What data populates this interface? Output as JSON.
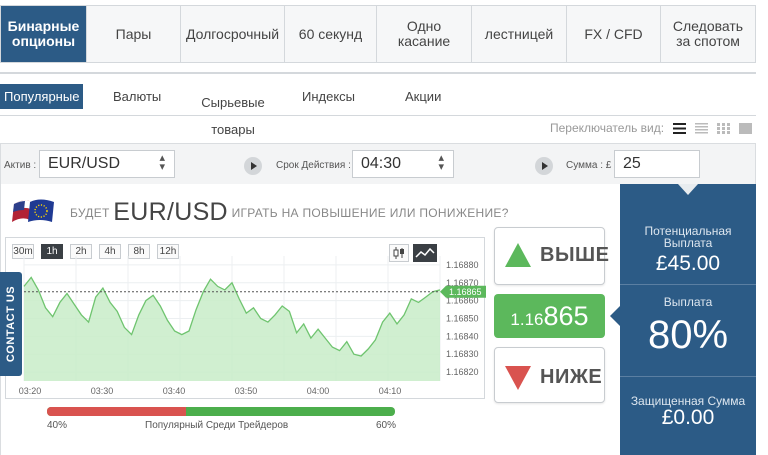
{
  "top_nav": [
    {
      "label": "Бинарные опционы",
      "active": true
    },
    {
      "label": "Пары"
    },
    {
      "label": "Долгосрочный"
    },
    {
      "label": "60 секунд"
    },
    {
      "label": "Одно касание"
    },
    {
      "label": "лестницей"
    },
    {
      "label": "FX / CFD"
    },
    {
      "label": "Следовать за спотом"
    }
  ],
  "sub_nav": [
    {
      "label": "Популярные",
      "active": true
    },
    {
      "label": "Валюты"
    },
    {
      "label": "Сырьевые товары"
    },
    {
      "label": "Индексы"
    },
    {
      "label": "Акции"
    }
  ],
  "view_switch": {
    "label": "Переключатель вид:"
  },
  "controls": {
    "asset_label": "Актив :",
    "asset_value": "EUR/USD",
    "expiry_label": "Срок Действия :",
    "expiry_value": "04:30",
    "amount_label": "Сумма : £",
    "amount_value": "25"
  },
  "headline": {
    "prefix": "БУДЕТ",
    "pair": "EUR/USD",
    "suffix": "ИГРАТЬ НА ПОВЫШЕНИЕ ИЛИ ПОНИЖЕНИЕ?"
  },
  "timeframes": [
    "30m",
    "1h",
    "2h",
    "4h",
    "8h",
    "12h"
  ],
  "active_timeframe": "1h",
  "contact_label": "CONTACT US",
  "chart_data": {
    "type": "area",
    "x_ticks": [
      "03:20",
      "03:30",
      "03:40",
      "03:50",
      "04:00",
      "04:10"
    ],
    "y_ticks": [
      "1.16880",
      "1.16870",
      "1.16860",
      "1.16850",
      "1.16840",
      "1.16830",
      "1.16820"
    ],
    "ylim": [
      1.16815,
      1.16885
    ],
    "current_price_label": "1.16865",
    "series": [
      {
        "values": [
          1.16868,
          1.16873,
          1.16866,
          1.16856,
          1.16851,
          1.16859,
          1.16864,
          1.16858,
          1.16852,
          1.16848,
          1.16862,
          1.16867,
          1.16859,
          1.16854,
          1.16845,
          1.16841,
          1.16852,
          1.1686,
          1.16863,
          1.16857,
          1.16849,
          1.16843,
          1.16841,
          1.16843,
          1.16855,
          1.16865,
          1.16872,
          1.16868,
          1.16866,
          1.1687,
          1.16861,
          1.16853,
          1.16856,
          1.1685,
          1.16848,
          1.16852,
          1.16857,
          1.16854,
          1.16842,
          1.16847,
          1.16839,
          1.16844,
          1.16839,
          1.16834,
          1.16832,
          1.16837,
          1.1683,
          1.16829,
          1.16833,
          1.16838,
          1.16848,
          1.16853,
          1.16847,
          1.16852,
          1.16861,
          1.16859,
          1.16862,
          1.16865,
          1.16866
        ]
      }
    ]
  },
  "popularity": {
    "left_pct": "40%",
    "label": "Популярный Среди Трейдеров",
    "right_pct": "60%",
    "down_fraction": 0.4
  },
  "buttons": {
    "up": "ВЫШЕ",
    "down": "НИЖЕ",
    "price_small": "1.16",
    "price_big": "865"
  },
  "right_panel": {
    "potential_label": "Потенциальная Выплата",
    "potential_value": "£45.00",
    "payout_label": "Выплата",
    "payout_value": "80%",
    "protected_label": "Защищенная Сумма",
    "protected_value": "£0.00"
  },
  "colors": {
    "accent": "#2c5b86",
    "up": "#5cb85c",
    "down": "#d9534f"
  }
}
